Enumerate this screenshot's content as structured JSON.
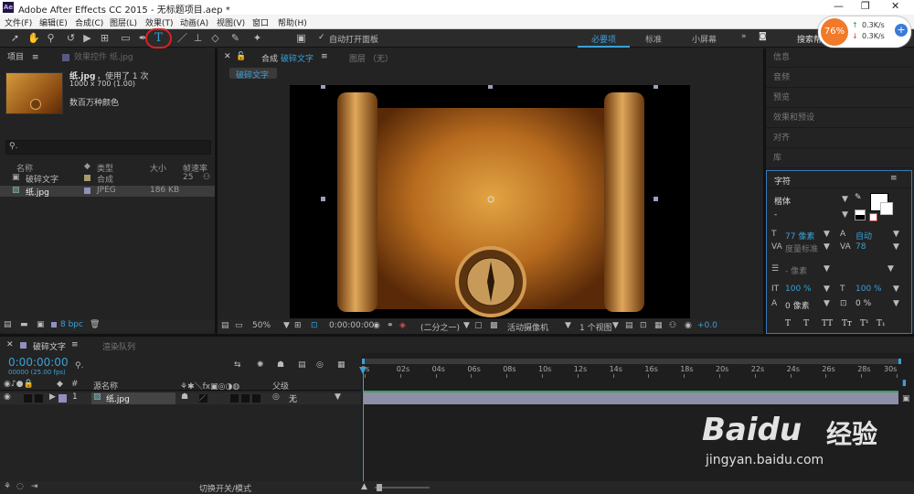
{
  "app": {
    "title": "Adobe After Effects CC 2015 - 无标题项目.aep *",
    "logo_text": "Ae"
  },
  "menu": [
    "文件(F)",
    "编辑(E)",
    "合成(C)",
    "图层(L)",
    "效果(T)",
    "动画(A)",
    "视图(V)",
    "窗口",
    "帮助(H)"
  ],
  "toolbar": {
    "auto_open_label": "自动打开面板",
    "workspaces": [
      "必要项",
      "标准",
      "小屏幕"
    ],
    "active_workspace": "必要项",
    "search_label": "搜索帮助"
  },
  "net": {
    "percent": "76%",
    "up": "0.3K/s",
    "down": "0.3K/s"
  },
  "project": {
    "tab_project": "项目",
    "tab_effects": "效果控件 纸.jpg",
    "asset_name": "纸.jpg",
    "asset_used": "，使用了 1 次",
    "asset_dims": "1000 x 700 (1.00)",
    "asset_colors": "数百万种颜色",
    "col_name": "名称",
    "col_type": "类型",
    "col_size": "大小",
    "col_fps": "帧速率",
    "items": [
      {
        "name": "破碎文字",
        "type": "合成",
        "size": "",
        "fps": "25"
      },
      {
        "name": "纸.jpg",
        "type": "JPEG",
        "size": "186 KB",
        "fps": ""
      }
    ],
    "bpc": "8 bpc"
  },
  "comp": {
    "tab_comp_prefix": "合成",
    "tab_comp_name": "破碎文字",
    "tab_layer": "图层 （无）",
    "breadcrumb": "破碎文字",
    "zoom": "50%",
    "timecode": "0:00:00:00",
    "resolution": "(二分之一)",
    "camera": "活动摄像机",
    "views": "1 个视图",
    "exposure": "+0.0"
  },
  "right_panels": [
    "信息",
    "音频",
    "预览",
    "效果和预设",
    "对齐",
    "库"
  ],
  "character": {
    "title": "字符",
    "font": "楷体",
    "style": "-",
    "size": "77 像素",
    "leading": "自动",
    "kerning": "度量标准",
    "tracking": "78",
    "stroke_width": "- 像素",
    "vscale": "100 %",
    "hscale": "100 %",
    "baseline": "0 像素",
    "tsume": "0 %",
    "style_buttons": [
      "T",
      "T",
      "TT",
      "Tт",
      "T¹",
      "T₁"
    ]
  },
  "timeline": {
    "tab_name": "破碎文字",
    "tab_render": "渲染队列",
    "timecode": "0:00:00:00",
    "timecode_sub": "00000 (25.00 fps)",
    "col_source": "源名称",
    "col_parent": "父级",
    "ticks": [
      "0s",
      "02s",
      "04s",
      "06s",
      "08s",
      "10s",
      "12s",
      "14s",
      "16s",
      "18s",
      "20s",
      "22s",
      "24s",
      "26s",
      "28s",
      "30s"
    ],
    "layers": [
      {
        "index": "1",
        "name": "纸.jpg",
        "parent": "无"
      }
    ],
    "footer_label": "切换开关/模式"
  },
  "watermark": {
    "brand": "Baidu",
    "cn": "经验",
    "url": "jingyan.baidu.com"
  },
  "colors": {
    "accent": "#3aa0d8",
    "highlight_red": "#e02020",
    "bar": "#8e8ea8"
  }
}
